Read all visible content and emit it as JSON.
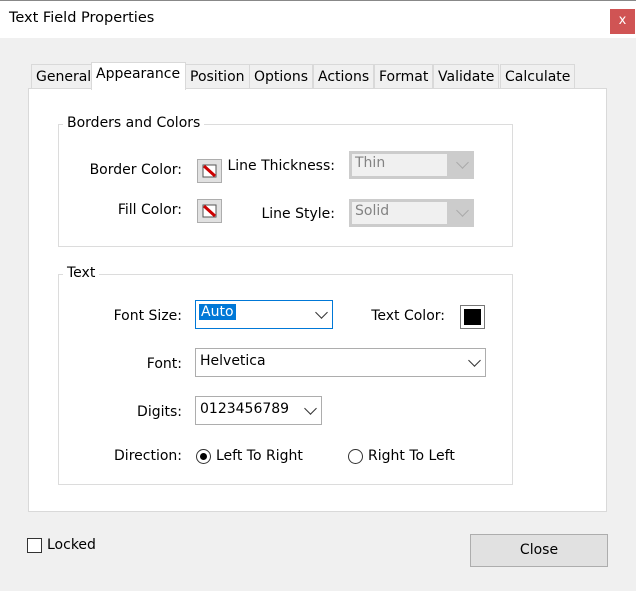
{
  "window": {
    "title": "Text Field Properties",
    "close_glyph": "x"
  },
  "tabs": [
    "General",
    "Appearance",
    "Position",
    "Options",
    "Actions",
    "Format",
    "Validate",
    "Calculate"
  ],
  "active_tab": "Appearance",
  "borders": {
    "group_label": "Borders and Colors",
    "border_color_label": "Border Color:",
    "fill_color_label": "Fill Color:",
    "line_thickness_label": "Line Thickness:",
    "line_thickness_value": "Thin",
    "line_style_label": "Line Style:",
    "line_style_value": "Solid"
  },
  "text": {
    "group_label": "Text",
    "font_size_label": "Font Size:",
    "font_size_value": "Auto",
    "text_color_label": "Text Color:",
    "text_color": "#000000",
    "font_label": "Font:",
    "font_value": "Helvetica",
    "digits_label": "Digits:",
    "digits_value": "0123456789",
    "direction_label": "Direction:",
    "ltr_label": "Left To Right",
    "rtl_label": "Right To Left",
    "direction_selected": "Left To Right"
  },
  "footer": {
    "locked_label": "Locked",
    "locked_checked": false,
    "close_label": "Close"
  },
  "colors": {
    "selection": "#0078d7",
    "close_button": "#d05454"
  }
}
